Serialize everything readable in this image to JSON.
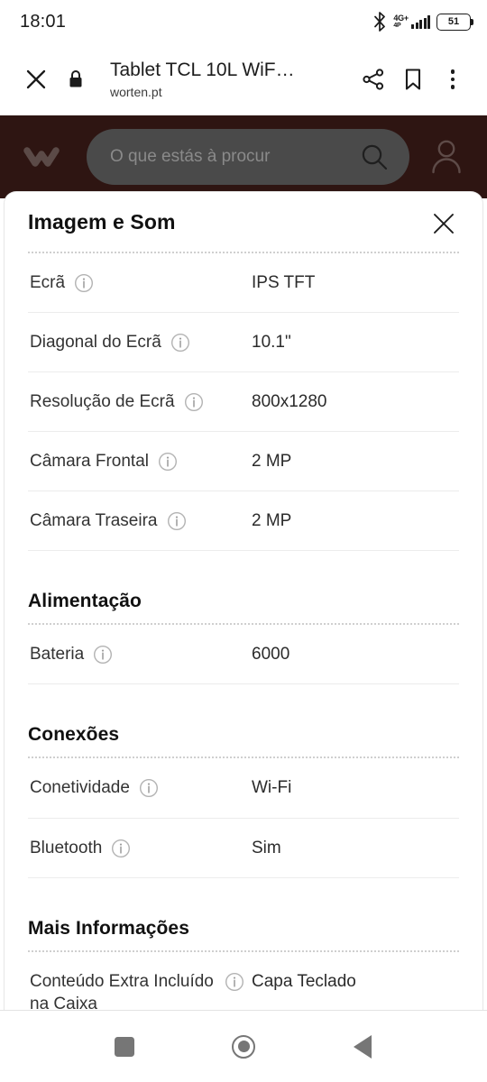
{
  "status_bar": {
    "time": "18:01",
    "bluetooth_icon": "bluetooth-icon",
    "network_label": "4G+",
    "network_sub_label": "4P",
    "signal_icon": "signal-bars-icon",
    "battery_level": "51"
  },
  "browser_bar": {
    "close_icon": "close-icon",
    "lock_icon": "lock-icon",
    "page_title": "Tablet TCL 10L WiF…",
    "page_url": "worten.pt",
    "share_icon": "share-icon",
    "bookmark_icon": "bookmark-icon",
    "overflow_icon": "more-vertical-icon"
  },
  "site_header": {
    "logo_icon": "worten-logo-icon",
    "search_placeholder": "O que estás à procur",
    "search_icon": "search-icon",
    "account_icon": "account-icon",
    "background_color": "#2e1512",
    "search_background_color": "#4a4a4a"
  },
  "modal": {
    "title": "Imagem e Som",
    "close_icon": "close-icon",
    "info_icon": "info-icon",
    "sections": [
      {
        "heading": null,
        "rows": [
          {
            "label": "Ecrã",
            "value": "IPS TFT"
          },
          {
            "label": "Diagonal do Ecrã",
            "value": "10.1\""
          },
          {
            "label": "Resolução de Ecrã",
            "value": "800x1280"
          },
          {
            "label": "Câmara Frontal",
            "value": "2 MP"
          },
          {
            "label": "Câmara Traseira",
            "value": "2 MP"
          }
        ]
      },
      {
        "heading": "Alimentação",
        "rows": [
          {
            "label": "Bateria",
            "value": "6000"
          }
        ]
      },
      {
        "heading": "Conexões",
        "rows": [
          {
            "label": "Conetividade",
            "value": "Wi-Fi"
          },
          {
            "label": "Bluetooth",
            "value": "Sim"
          }
        ]
      },
      {
        "heading": "Mais Informações",
        "rows": [
          {
            "label": "Conteúdo Extra Incluído na Caixa",
            "value": "Capa Teclado"
          }
        ]
      }
    ]
  },
  "nav_bar": {
    "recents_icon": "recents-square-icon",
    "home_icon": "home-circle-icon",
    "back_icon": "back-triangle-icon"
  }
}
